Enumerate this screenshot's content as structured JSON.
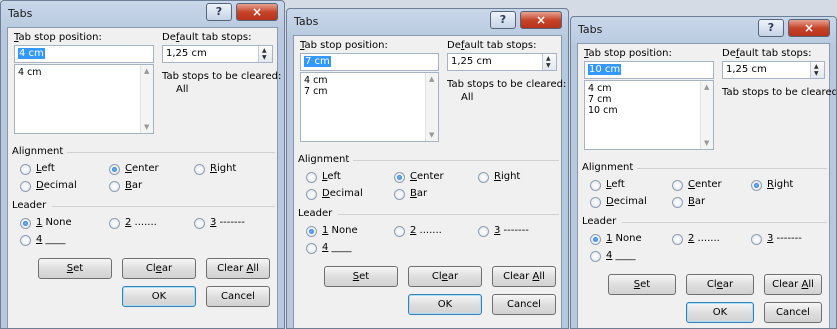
{
  "dialogs": [
    {
      "title": "Tabs",
      "help_glyph": "?",
      "close_glyph": "×",
      "tab_stop_position_label_pre": "",
      "tab_stop_position_label_key": "T",
      "tab_stop_position_label_post": "ab stop position:",
      "default_tab_stops_label_pre": "De",
      "default_tab_stops_label_key": "f",
      "default_tab_stops_label_post": "ault tab stops:",
      "tab_stop_value": "4 cm",
      "default_tab_value": "1,25 cm",
      "tab_stops": [
        "4 cm"
      ],
      "to_be_cleared_label": "Tab stops to be cleared:",
      "to_be_cleared_value": "All",
      "alignment_label": "Alignment",
      "alignment_selected": "Center",
      "leader_label": "Leader",
      "leader_selected": "1 None"
    },
    {
      "title": "Tabs",
      "help_glyph": "?",
      "close_glyph": "×",
      "tab_stop_position_label_pre": "",
      "tab_stop_position_label_key": "T",
      "tab_stop_position_label_post": "ab stop position:",
      "default_tab_stops_label_pre": "De",
      "default_tab_stops_label_key": "f",
      "default_tab_stops_label_post": "ault tab stops:",
      "tab_stop_value": "7 cm",
      "default_tab_value": "1,25 cm",
      "tab_stops": [
        "4 cm",
        "7 cm"
      ],
      "to_be_cleared_label": "Tab stops to be cleared:",
      "to_be_cleared_value": "All",
      "alignment_label": "Alignment",
      "alignment_selected": "Center",
      "leader_label": "Leader",
      "leader_selected": "1 None"
    },
    {
      "title": "Tabs",
      "help_glyph": "?",
      "close_glyph": "×",
      "tab_stop_position_label_pre": "",
      "tab_stop_position_label_key": "T",
      "tab_stop_position_label_post": "ab stop position:",
      "default_tab_stops_label_pre": "De",
      "default_tab_stops_label_key": "f",
      "default_tab_stops_label_post": "ault tab stops:",
      "tab_stop_value": "10 cm",
      "default_tab_value": "1,25 cm",
      "tab_stops": [
        "4 cm",
        "7 cm",
        "10 cm"
      ],
      "to_be_cleared_label": "Tab stops to be cleared:",
      "to_be_cleared_value": "",
      "alignment_label": "Alignment",
      "alignment_selected": "Right",
      "leader_label": "Leader",
      "leader_selected": "1 None"
    }
  ],
  "alignment_options": [
    {
      "key": "L",
      "rest": "eft",
      "pre": ""
    },
    {
      "key": "C",
      "rest": "enter",
      "pre": ""
    },
    {
      "key": "R",
      "rest": "ight",
      "pre": ""
    },
    {
      "key": "D",
      "rest": "ecimal",
      "pre": ""
    },
    {
      "key": "B",
      "rest": "ar",
      "pre": ""
    }
  ],
  "leader_options": [
    {
      "key": "1",
      "rest": " None"
    },
    {
      "key": "2",
      "rest": " ......."
    },
    {
      "key": "3",
      "rest": " -------"
    },
    {
      "key": "4",
      "rest": " ____"
    }
  ],
  "buttons": {
    "set_key": "S",
    "set_rest": "et",
    "clear_pre": "Cl",
    "clear_key": "e",
    "clear_rest": "ar",
    "clear_all_pre": "Clear ",
    "clear_all_key": "A",
    "clear_all_rest": "ll",
    "ok": "OK",
    "cancel": "Cancel"
  },
  "colors": {
    "title_bar": "#c9d7ea",
    "close_button": "#c6452a",
    "selection": "#3399ff",
    "dialog_body": "#f0f0f0"
  },
  "icons": [
    "help-icon",
    "close-icon",
    "spin-up-icon",
    "spin-down-icon",
    "scroll-up-icon",
    "scroll-down-icon"
  ]
}
